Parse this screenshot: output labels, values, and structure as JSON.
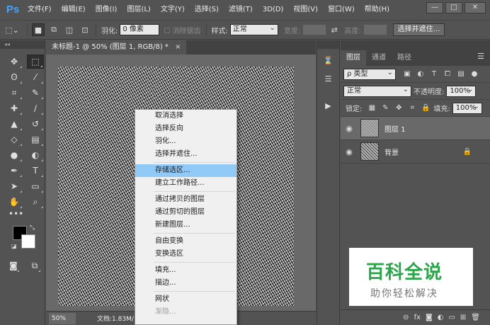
{
  "app": {
    "logo": "Ps"
  },
  "menubar": {
    "items": [
      "文件(F)",
      "编辑(E)",
      "图像(I)",
      "图层(L)",
      "文字(Y)",
      "选择(S)",
      "滤镜(T)",
      "3D(D)",
      "视图(V)",
      "窗口(W)",
      "帮助(H)"
    ]
  },
  "window_controls": {
    "minimize": "—",
    "maximize": "□",
    "close": "✕"
  },
  "options": {
    "feather_label": "羽化:",
    "feather_value": "0 像素",
    "antialias_label": "消除锯齿",
    "style_label": "样式:",
    "style_value": "正常",
    "width_label": "宽度:",
    "height_label": "高度:",
    "select_mask_button": "选择并遮住..."
  },
  "document": {
    "tab_title": "未标题-1 @ 50% (图层 1, RGB/8) *",
    "close": "×",
    "zoom": "50%",
    "info": "文档:1.83M/"
  },
  "context_menu": {
    "groups": [
      [
        "取消选择",
        "选择反向",
        "羽化...",
        "选择并遮住..."
      ],
      [
        "存储选区...",
        "建立工作路径..."
      ],
      [
        "通过拷贝的图层",
        "通过剪切的图层",
        "新建图层..."
      ],
      [
        "自由变换",
        "变换选区"
      ],
      [
        "填充...",
        "描边..."
      ],
      [
        "网状",
        "渐隐..."
      ]
    ],
    "highlighted": "存储选区...",
    "disabled": "渐隐..."
  },
  "layers_panel": {
    "tabs": [
      "图层",
      "通道",
      "路径"
    ],
    "kind_filter": "ρ 类型",
    "blend_mode": "正常",
    "opacity_label": "不透明度:",
    "opacity_value": "100%",
    "lock_label": "锁定:",
    "fill_label": "填充:",
    "fill_value": "100%",
    "layers": [
      {
        "name": "图层 1",
        "selected": true
      },
      {
        "name": "背景",
        "locked": true
      }
    ]
  },
  "watermark": {
    "title": "百科全说",
    "subtitle": "助你轻松解决"
  },
  "colors": {
    "accent_highlight": "#91c9f7",
    "watermark_green": "#2aa54a",
    "ps_blue": "#3fa5ff"
  }
}
